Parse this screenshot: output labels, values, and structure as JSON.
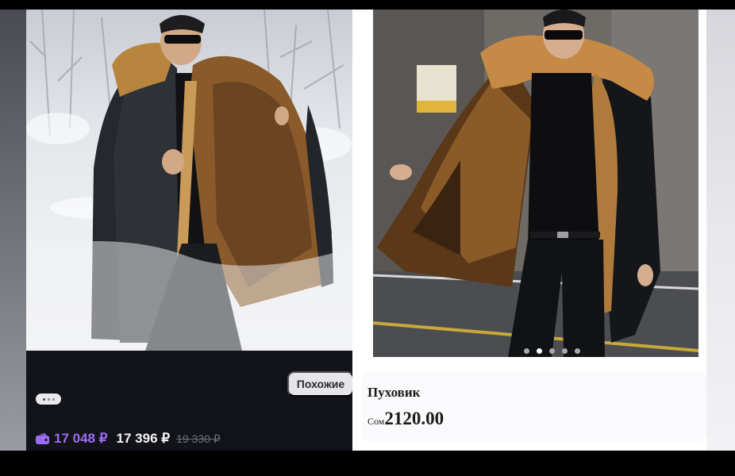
{
  "left_card": {
    "similar_button": "Похожие",
    "price_wallet": "17 048 ₽",
    "price_main": "17 396 ₽",
    "price_old": "19 330 ₽",
    "colors": {
      "wallet_price": "#9d6cf7",
      "card_bg": "#121318"
    }
  },
  "right_card": {
    "title": "Пуховик",
    "currency": "Сом",
    "price": "2120.00",
    "carousel": {
      "count": 5,
      "active": 2
    }
  },
  "icons": {
    "wallet": "wallet-icon",
    "indicator": "dots-indicator"
  }
}
